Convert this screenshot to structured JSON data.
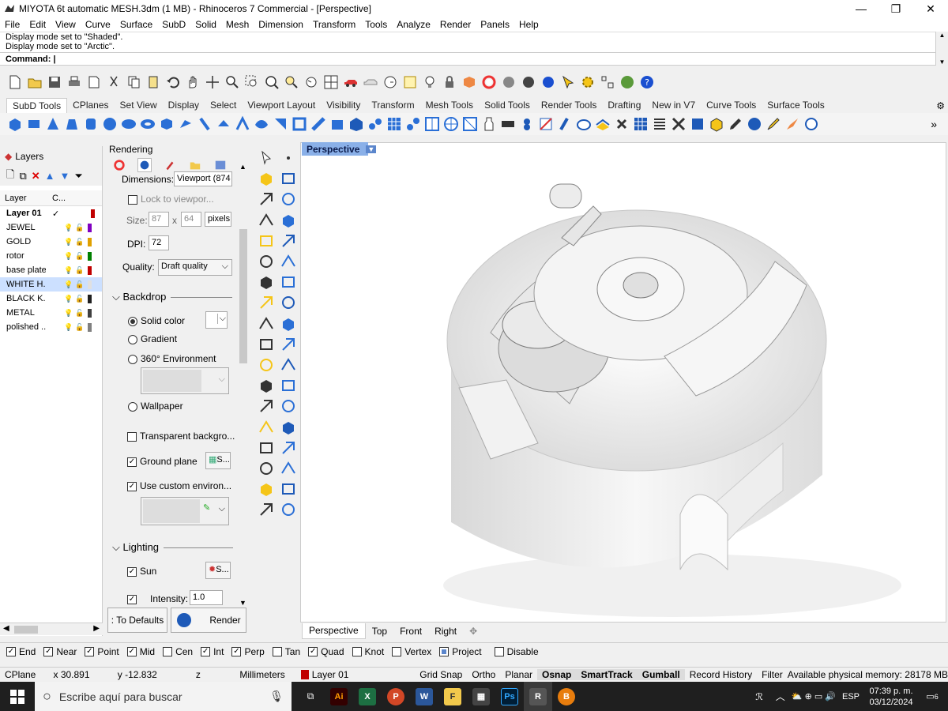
{
  "window": {
    "title": "MIYOTA 6t automatic MESH.3dm (1 MB) - Rhinoceros 7 Commercial - [Perspective]",
    "minimize": "—",
    "restore": "❐",
    "close": "✕"
  },
  "menu": [
    "File",
    "Edit",
    "View",
    "Curve",
    "Surface",
    "SubD",
    "Solid",
    "Mesh",
    "Dimension",
    "Transform",
    "Tools",
    "Analyze",
    "Render",
    "Panels",
    "Help"
  ],
  "command": {
    "history": [
      "Display mode set to \"Shaded\".",
      "Display mode set to \"Arctic\"."
    ],
    "prompt": "Command:"
  },
  "toolbar_tabs": [
    "SubD Tools",
    "CPlanes",
    "Set View",
    "Display",
    "Select",
    "Viewport Layout",
    "Visibility",
    "Transform",
    "Mesh Tools",
    "Solid Tools",
    "Render Tools",
    "Drafting",
    "New in V7",
    "Curve Tools",
    "Surface Tools"
  ],
  "layers": {
    "title": "Layers",
    "col_layer": "Layer",
    "col_current": "C...",
    "rows": [
      {
        "name": "Layer 01",
        "current": "✓",
        "color": "#c00000",
        "bold": true
      },
      {
        "name": "JEWEL",
        "color": "#8000c0"
      },
      {
        "name": "GOLD",
        "color": "#e0a000"
      },
      {
        "name": "rotor",
        "color": "#008000"
      },
      {
        "name": "base plate",
        "color": "#c00000"
      },
      {
        "name": "WHITE H...",
        "color": "#e0e0e0",
        "selected": true
      },
      {
        "name": "BLACK K...",
        "color": "#202020"
      },
      {
        "name": "METAL",
        "color": "#404040"
      },
      {
        "name": "polished ...",
        "color": "#808080"
      }
    ]
  },
  "rendering": {
    "title": "Rendering",
    "dimensions_label": "Dimensions:",
    "dimensions_value": "Viewport (874",
    "lock_label": "Lock to viewpor...",
    "size_label": "Size:",
    "size_w": "87",
    "size_x": "x",
    "size_h": "64",
    "size_unit": "pixels",
    "dpi_label": "DPI:",
    "dpi_value": "72",
    "quality_label": "Quality:",
    "quality_value": "Draft quality",
    "backdrop": "Backdrop",
    "solid_color": "Solid color",
    "gradient": "Gradient",
    "env360": "360° Environment",
    "wallpaper": "Wallpaper",
    "transparent": "Transparent backgro...",
    "ground_plane": "Ground plane",
    "custom_env": "Use custom environ...",
    "lighting": "Lighting",
    "sun": "Sun",
    "skylight_intensity_label": "Intensity:",
    "skylight_intensity": "1.0",
    "btn_defaults": ": To Defaults",
    "btn_render": "Render",
    "settings_small": "S..."
  },
  "viewport": {
    "label": "Perspective",
    "tabs": [
      "Perspective",
      "Top",
      "Front",
      "Right"
    ],
    "add": "✥"
  },
  "osnap": [
    {
      "label": "End",
      "on": true
    },
    {
      "label": "Near",
      "on": true
    },
    {
      "label": "Point",
      "on": true
    },
    {
      "label": "Mid",
      "on": true
    },
    {
      "label": "Cen",
      "on": false
    },
    {
      "label": "Int",
      "on": true
    },
    {
      "label": "Perp",
      "on": true
    },
    {
      "label": "Tan",
      "on": false
    },
    {
      "label": "Quad",
      "on": true
    },
    {
      "label": "Knot",
      "on": false
    },
    {
      "label": "Vertex",
      "on": false
    },
    {
      "label": "Project",
      "on": true
    },
    {
      "label": "Disable",
      "on": false
    }
  ],
  "status": {
    "cplane": "CPlane",
    "x": "x 30.891",
    "y": "y -12.832",
    "z": "z",
    "units": "Millimeters",
    "layer": "Layer 01",
    "grid_snap": "Grid Snap",
    "ortho": "Ortho",
    "planar": "Planar",
    "osnap": "Osnap",
    "smarttrack": "SmartTrack",
    "gumball": "Gumball",
    "record_history": "Record History",
    "filter": "Filter",
    "memory": "Available physical memory: 28178 MB"
  },
  "taskbar": {
    "search_placeholder": "Escribe aquí para buscar",
    "lang": "ESP",
    "time": "07:39 p. m.",
    "date": "03/12/2024",
    "notifications": "6",
    "apps": [
      "Ai",
      "X",
      "P",
      "W",
      "F",
      "▦",
      "Ps",
      "R",
      "B"
    ]
  }
}
